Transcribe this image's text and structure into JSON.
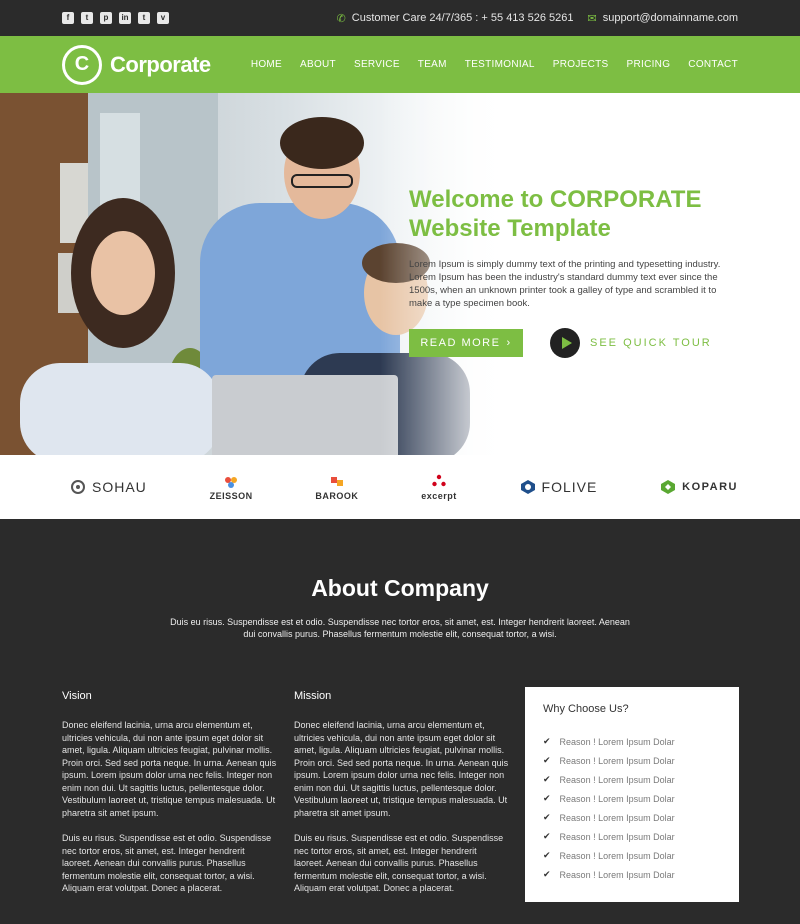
{
  "topbar": {
    "socials": [
      {
        "icon": "facebook-icon",
        "glyph": "f"
      },
      {
        "icon": "twitter-icon",
        "glyph": "t"
      },
      {
        "icon": "pinterest-icon",
        "glyph": "p"
      },
      {
        "icon": "linkedin-icon",
        "glyph": "in"
      },
      {
        "icon": "tumblr-icon",
        "glyph": "t"
      },
      {
        "icon": "vimeo-icon",
        "glyph": "v"
      }
    ],
    "phone_label": "Customer Care 24/7/365 : + 55 413 526 5261",
    "email_label": "support@domainname.com"
  },
  "nav": {
    "logo_letter": "C",
    "logo_text": "Corporate",
    "items": [
      "HOME",
      "ABOUT",
      "SERVICE",
      "TEAM",
      "TESTIMONIAL",
      "PROJECTS",
      "PRICING",
      "CONTACT"
    ]
  },
  "hero": {
    "title": "Welcome to CORPORATE Website Template",
    "text": "Lorem Ipsum is simply dummy text of the printing and typesetting industry. Lorem Ipsum has been the industry's standard dummy text ever since the 1500s, when an unknown printer took a galley of type and scrambled it to make a type specimen book.",
    "read_more": "READ MORE",
    "tour": "SEE QUICK TOUR"
  },
  "brands": [
    "SOHAU",
    "ZEISSON",
    "BAROOK",
    "excerpt",
    "FOLIVE",
    "KOPARU"
  ],
  "about": {
    "title": "About Company",
    "subtitle": "Duis eu risus. Suspendisse est et odio. Suspendisse nec tortor eros, sit amet, est. Integer hendrerit laoreet. Aenean dui convallis purus. Phasellus fermentum molestie elit, consequat tortor, a wisi.",
    "vision_title": "Vision",
    "vision_p1": "Donec eleifend lacinia, urna arcu elementum et, ultricies vehicula, dui non ante ipsum eget dolor sit amet, ligula. Aliquam ultricies feugiat, pulvinar mollis. Proin orci. Sed sed porta neque. In urna. Aenean quis ipsum. Lorem ipsum dolor urna nec felis. Integer non enim non dui. Ut sagittis luctus, pellentesque dolor. Vestibulum laoreet ut, tristique tempus malesuada. Ut pharetra sit amet ipsum.",
    "vision_p2": "Duis eu risus. Suspendisse est et odio. Suspendisse nec tortor eros, sit amet, est. Integer hendrerit laoreet. Aenean dui convallis purus. Phasellus fermentum molestie elit, consequat tortor, a wisi. Aliquam erat volutpat. Donec a placerat.",
    "mission_title": "Mission",
    "mission_p1": "Donec eleifend lacinia, urna arcu elementum et, ultricies vehicula, dui non ante ipsum eget dolor sit amet, ligula. Aliquam ultricies feugiat, pulvinar mollis. Proin orci. Sed sed porta neque. In urna. Aenean quis ipsum. Lorem ipsum dolor urna nec felis. Integer non enim non dui. Ut sagittis luctus, pellentesque dolor. Vestibulum laoreet ut, tristique tempus malesuada. Ut pharetra sit amet ipsum.",
    "mission_p2": "Duis eu risus. Suspendisse est et odio. Suspendisse nec tortor eros, sit amet, est. Integer hendrerit laoreet. Aenean dui convallis purus. Phasellus fermentum molestie elit, consequat tortor, a wisi. Aliquam erat volutpat. Donec a placerat.",
    "why_title": "Why Choose Us?",
    "reasons": [
      "Reason ! Lorem Ipsum Dolar",
      "Reason ! Lorem Ipsum Dolar",
      "Reason ! Lorem Ipsum Dolar",
      "Reason ! Lorem Ipsum Dolar",
      "Reason ! Lorem Ipsum Dolar",
      "Reason ! Lorem Ipsum Dolar",
      "Reason ! Lorem Ipsum Dolar",
      "Reason ! Lorem Ipsum Dolar"
    ]
  },
  "colors": {
    "accent": "#7dbe43",
    "dark": "#2b2b2b",
    "white": "#ffffff"
  }
}
